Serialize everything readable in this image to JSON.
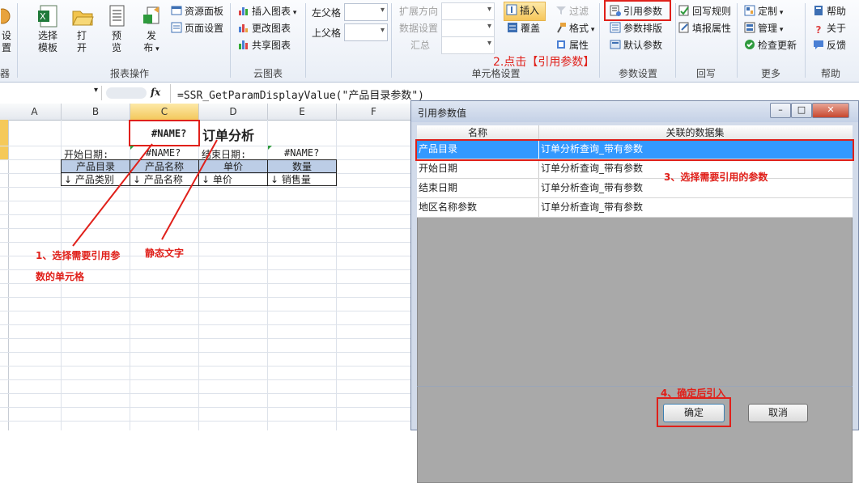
{
  "ribbon": {
    "left_partial": {
      "top": "设",
      "bottom": "置",
      "group": "器"
    },
    "big_buttons": [
      {
        "id": "select-template",
        "line1": "选择",
        "line2": "模板"
      },
      {
        "id": "open",
        "line1": "打",
        "line2": "开"
      },
      {
        "id": "preview",
        "line1": "预",
        "line2": "览"
      },
      {
        "id": "publish",
        "line1": "发",
        "line2": "布"
      }
    ],
    "resource_panel": "资源面板",
    "page_setup": "页面设置",
    "group_report": "报表操作",
    "insert_chart": "插入图表",
    "change_chart": "更改图表",
    "share_chart": "共享图表",
    "group_cloud": "云图表",
    "left_parent": "左父格",
    "top_parent": "上父格",
    "expand_direction": "扩展方向",
    "data_setting": "数据设置",
    "summary": "汇总",
    "insert": "插入",
    "overwrite": "覆盖",
    "filter": "过滤",
    "format": "格式",
    "attributes": "属性",
    "group_cell": "单元格设置",
    "ref_param": "引用参数",
    "param_sort": "参数排版",
    "default_param": "默认参数",
    "group_param": "参数设置",
    "writeback_rule": "回写规则",
    "fill_attr": "填报属性",
    "group_writeback": "回写",
    "customize": "定制",
    "manage": "管理",
    "check_update": "检查更新",
    "group_more": "更多",
    "help": "帮助",
    "about": "关于",
    "feedback": "反馈",
    "group_help": "帮助",
    "annotation2": "2.点击【引用参数】"
  },
  "formula_bar": {
    "fx": "fx",
    "formula": "=SSR_GetParamDisplayValue(\"产品目录参数\")"
  },
  "sheet": {
    "columns": [
      "A",
      "B",
      "C",
      "D",
      "E",
      "F"
    ],
    "name_error": "#NAME?",
    "title_static": "订单分析",
    "start_date_label": "开始日期:",
    "end_date_label": "结束日期:",
    "name_error_b": "#NAME?",
    "name_error_e": "#NAME?",
    "headers": [
      "产品目录",
      "产品名称",
      "单价",
      "数量"
    ],
    "fields": [
      "↓ 产品类别",
      "↓ 产品名称",
      "↓ 单价",
      "↓ 销售量"
    ],
    "annotation1_line1": "1、选择需要引用参",
    "annotation1_line2": "数的单元格",
    "annotation_static": "静态文字"
  },
  "dialog": {
    "title": "引用参数值",
    "col_name": "名称",
    "col_dataset": "关联的数据集",
    "rows": [
      {
        "name": "产品目录",
        "dataset": "订单分析查询_带有参数"
      },
      {
        "name": "开始日期",
        "dataset": "订单分析查询_带有参数"
      },
      {
        "name": "结束日期",
        "dataset": "订单分析查询_带有参数"
      },
      {
        "name": "地区名称参数",
        "dataset": "订单分析查询_带有参数"
      }
    ],
    "annotation3": "3、选择需要引用的参数",
    "annotation4": "4、确定后引入",
    "ok": "确定",
    "cancel": "取消"
  },
  "colors": {
    "accent_red": "#e0201a",
    "selected_row": "#3399ff"
  }
}
